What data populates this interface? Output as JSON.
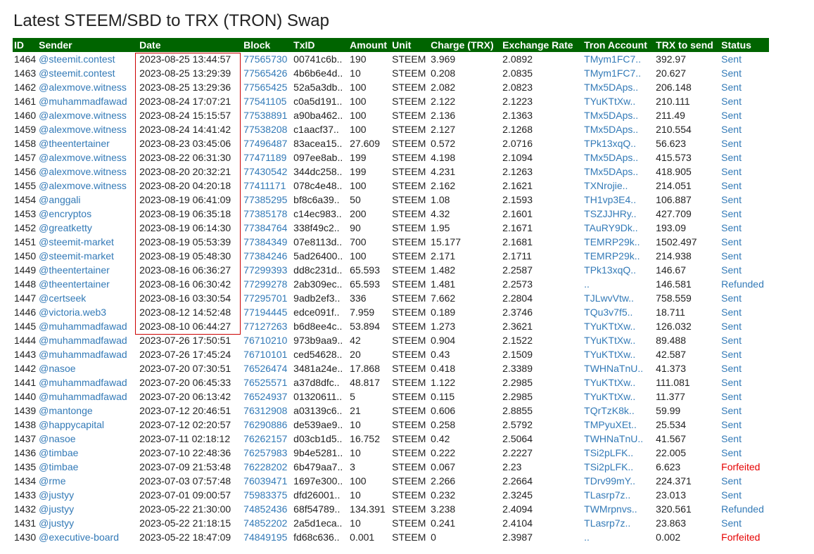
{
  "page": {
    "title": "Latest STEEM/SBD to TRX (TRON) Swap"
  },
  "colors": {
    "header_bg": "#006400",
    "link": "#337ab7",
    "forfeited": "#e60000",
    "highlight_border": "#cc0000"
  },
  "table": {
    "headers": [
      "ID",
      "Sender",
      "Date",
      "Block",
      "TxID",
      "Amount",
      "Unit",
      "Charge (TRX)",
      "Exchange Rate",
      "Tron Account",
      "TRX to send",
      "Status"
    ],
    "rows": [
      {
        "id": "1464",
        "sender": "@steemit.contest",
        "date": "2023-08-25 13:44:57",
        "block": "77565730",
        "txid": "00741c6b..",
        "amount": "190",
        "unit": "STEEM",
        "charge": "3.969",
        "rate": "2.0892",
        "tron": "TMym1FC7..",
        "trx": "392.97",
        "status": "Sent"
      },
      {
        "id": "1463",
        "sender": "@steemit.contest",
        "date": "2023-08-25 13:29:39",
        "block": "77565426",
        "txid": "4b6b6e4d..",
        "amount": "10",
        "unit": "STEEM",
        "charge": "0.208",
        "rate": "2.0835",
        "tron": "TMym1FC7..",
        "trx": "20.627",
        "status": "Sent"
      },
      {
        "id": "1462",
        "sender": "@alexmove.witness",
        "date": "2023-08-25 13:29:36",
        "block": "77565425",
        "txid": "52a5a3db..",
        "amount": "100",
        "unit": "STEEM",
        "charge": "2.082",
        "rate": "2.0823",
        "tron": "TMx5DAps..",
        "trx": "206.148",
        "status": "Sent"
      },
      {
        "id": "1461",
        "sender": "@muhammadfawad",
        "date": "2023-08-24 17:07:21",
        "block": "77541105",
        "txid": "c0a5d191..",
        "amount": "100",
        "unit": "STEEM",
        "charge": "2.122",
        "rate": "2.1223",
        "tron": "TYuKTtXw..",
        "trx": "210.111",
        "status": "Sent"
      },
      {
        "id": "1460",
        "sender": "@alexmove.witness",
        "date": "2023-08-24 15:15:57",
        "block": "77538891",
        "txid": "a90ba462..",
        "amount": "100",
        "unit": "STEEM",
        "charge": "2.136",
        "rate": "2.1363",
        "tron": "TMx5DAps..",
        "trx": "211.49",
        "status": "Sent"
      },
      {
        "id": "1459",
        "sender": "@alexmove.witness",
        "date": "2023-08-24 14:41:42",
        "block": "77538208",
        "txid": "c1aacf37..",
        "amount": "100",
        "unit": "STEEM",
        "charge": "2.127",
        "rate": "2.1268",
        "tron": "TMx5DAps..",
        "trx": "210.554",
        "status": "Sent"
      },
      {
        "id": "1458",
        "sender": "@theentertainer",
        "date": "2023-08-23 03:45:06",
        "block": "77496487",
        "txid": "83acea15..",
        "amount": "27.609",
        "unit": "STEEM",
        "charge": "0.572",
        "rate": "2.0716",
        "tron": "TPk13xqQ..",
        "trx": "56.623",
        "status": "Sent"
      },
      {
        "id": "1457",
        "sender": "@alexmove.witness",
        "date": "2023-08-22 06:31:30",
        "block": "77471189",
        "txid": "097ee8ab..",
        "amount": "199",
        "unit": "STEEM",
        "charge": "4.198",
        "rate": "2.1094",
        "tron": "TMx5DAps..",
        "trx": "415.573",
        "status": "Sent"
      },
      {
        "id": "1456",
        "sender": "@alexmove.witness",
        "date": "2023-08-20 20:32:21",
        "block": "77430542",
        "txid": "344dc258..",
        "amount": "199",
        "unit": "STEEM",
        "charge": "4.231",
        "rate": "2.1263",
        "tron": "TMx5DAps..",
        "trx": "418.905",
        "status": "Sent"
      },
      {
        "id": "1455",
        "sender": "@alexmove.witness",
        "date": "2023-08-20 04:20:18",
        "block": "77411171",
        "txid": "078c4e48..",
        "amount": "100",
        "unit": "STEEM",
        "charge": "2.162",
        "rate": "2.1621",
        "tron": "TXNrojie..",
        "trx": "214.051",
        "status": "Sent"
      },
      {
        "id": "1454",
        "sender": "@anggali",
        "date": "2023-08-19 06:41:09",
        "block": "77385295",
        "txid": "bf8c6a39..",
        "amount": "50",
        "unit": "STEEM",
        "charge": "1.08",
        "rate": "2.1593",
        "tron": "TH1vp3E4..",
        "trx": "106.887",
        "status": "Sent"
      },
      {
        "id": "1453",
        "sender": "@encryptos",
        "date": "2023-08-19 06:35:18",
        "block": "77385178",
        "txid": "c14ec983..",
        "amount": "200",
        "unit": "STEEM",
        "charge": "4.32",
        "rate": "2.1601",
        "tron": "TSZJJHRy..",
        "trx": "427.709",
        "status": "Sent"
      },
      {
        "id": "1452",
        "sender": "@greatketty",
        "date": "2023-08-19 06:14:30",
        "block": "77384764",
        "txid": "338f49c2..",
        "amount": "90",
        "unit": "STEEM",
        "charge": "1.95",
        "rate": "2.1671",
        "tron": "TAuRY9Dk..",
        "trx": "193.09",
        "status": "Sent"
      },
      {
        "id": "1451",
        "sender": "@steemit-market",
        "date": "2023-08-19 05:53:39",
        "block": "77384349",
        "txid": "07e8113d..",
        "amount": "700",
        "unit": "STEEM",
        "charge": "15.177",
        "rate": "2.1681",
        "tron": "TEMRP29k..",
        "trx": "1502.497",
        "status": "Sent"
      },
      {
        "id": "1450",
        "sender": "@steemit-market",
        "date": "2023-08-19 05:48:30",
        "block": "77384246",
        "txid": "5ad26400..",
        "amount": "100",
        "unit": "STEEM",
        "charge": "2.171",
        "rate": "2.1711",
        "tron": "TEMRP29k..",
        "trx": "214.938",
        "status": "Sent"
      },
      {
        "id": "1449",
        "sender": "@theentertainer",
        "date": "2023-08-16 06:36:27",
        "block": "77299393",
        "txid": "dd8c231d..",
        "amount": "65.593",
        "unit": "STEEM",
        "charge": "1.482",
        "rate": "2.2587",
        "tron": "TPk13xqQ..",
        "trx": "146.67",
        "status": "Sent"
      },
      {
        "id": "1448",
        "sender": "@theentertainer",
        "date": "2023-08-16 06:30:42",
        "block": "77299278",
        "txid": "2ab309ec..",
        "amount": "65.593",
        "unit": "STEEM",
        "charge": "1.481",
        "rate": "2.2573",
        "tron": "..",
        "trx": "146.581",
        "status": "Refunded"
      },
      {
        "id": "1447",
        "sender": "@certseek",
        "date": "2023-08-16 03:30:54",
        "block": "77295701",
        "txid": "9adb2ef3..",
        "amount": "336",
        "unit": "STEEM",
        "charge": "7.662",
        "rate": "2.2804",
        "tron": "TJLwvVtw..",
        "trx": "758.559",
        "status": "Sent"
      },
      {
        "id": "1446",
        "sender": "@victoria.web3",
        "date": "2023-08-12 14:52:48",
        "block": "77194445",
        "txid": "edce091f..",
        "amount": "7.959",
        "unit": "STEEM",
        "charge": "0.189",
        "rate": "2.3746",
        "tron": "TQu3v7f5..",
        "trx": "18.711",
        "status": "Sent"
      },
      {
        "id": "1445",
        "sender": "@muhammadfawad",
        "date": "2023-08-10 06:44:27",
        "block": "77127263",
        "txid": "b6d8ee4c..",
        "amount": "53.894",
        "unit": "STEEM",
        "charge": "1.273",
        "rate": "2.3621",
        "tron": "TYuKTtXw..",
        "trx": "126.032",
        "status": "Sent"
      },
      {
        "id": "1444",
        "sender": "@muhammadfawad",
        "date": "2023-07-26 17:50:51",
        "block": "76710210",
        "txid": "973b9aa9..",
        "amount": "42",
        "unit": "STEEM",
        "charge": "0.904",
        "rate": "2.1522",
        "tron": "TYuKTtXw..",
        "trx": "89.488",
        "status": "Sent"
      },
      {
        "id": "1443",
        "sender": "@muhammadfawad",
        "date": "2023-07-26 17:45:24",
        "block": "76710101",
        "txid": "ced54628..",
        "amount": "20",
        "unit": "STEEM",
        "charge": "0.43",
        "rate": "2.1509",
        "tron": "TYuKTtXw..",
        "trx": "42.587",
        "status": "Sent"
      },
      {
        "id": "1442",
        "sender": "@nasoe",
        "date": "2023-07-20 07:30:51",
        "block": "76526474",
        "txid": "3481a24e..",
        "amount": "17.868",
        "unit": "STEEM",
        "charge": "0.418",
        "rate": "2.3389",
        "tron": "TWHNaTnU..",
        "trx": "41.373",
        "status": "Sent"
      },
      {
        "id": "1441",
        "sender": "@muhammadfawad",
        "date": "2023-07-20 06:45:33",
        "block": "76525571",
        "txid": "a37d8dfc..",
        "amount": "48.817",
        "unit": "STEEM",
        "charge": "1.122",
        "rate": "2.2985",
        "tron": "TYuKTtXw..",
        "trx": "111.081",
        "status": "Sent"
      },
      {
        "id": "1440",
        "sender": "@muhammadfawad",
        "date": "2023-07-20 06:13:42",
        "block": "76524937",
        "txid": "01320611..",
        "amount": "5",
        "unit": "STEEM",
        "charge": "0.115",
        "rate": "2.2985",
        "tron": "TYuKTtXw..",
        "trx": "11.377",
        "status": "Sent"
      },
      {
        "id": "1439",
        "sender": "@mantonge",
        "date": "2023-07-12 20:46:51",
        "block": "76312908",
        "txid": "a03139c6..",
        "amount": "21",
        "unit": "STEEM",
        "charge": "0.606",
        "rate": "2.8855",
        "tron": "TQrTzK8k..",
        "trx": "59.99",
        "status": "Sent"
      },
      {
        "id": "1438",
        "sender": "@happycapital",
        "date": "2023-07-12 02:20:57",
        "block": "76290886",
        "txid": "de539ae9..",
        "amount": "10",
        "unit": "STEEM",
        "charge": "0.258",
        "rate": "2.5792",
        "tron": "TMPyuXEt..",
        "trx": "25.534",
        "status": "Sent"
      },
      {
        "id": "1437",
        "sender": "@nasoe",
        "date": "2023-07-11 02:18:12",
        "block": "76262157",
        "txid": "d03cb1d5..",
        "amount": "16.752",
        "unit": "STEEM",
        "charge": "0.42",
        "rate": "2.5064",
        "tron": "TWHNaTnU..",
        "trx": "41.567",
        "status": "Sent"
      },
      {
        "id": "1436",
        "sender": "@timbae",
        "date": "2023-07-10 22:48:36",
        "block": "76257983",
        "txid": "9b4e5281..",
        "amount": "10",
        "unit": "STEEM",
        "charge": "0.222",
        "rate": "2.2227",
        "tron": "TSi2pLFK..",
        "trx": "22.005",
        "status": "Sent"
      },
      {
        "id": "1435",
        "sender": "@timbae",
        "date": "2023-07-09 21:53:48",
        "block": "76228202",
        "txid": "6b479aa7..",
        "amount": "3",
        "unit": "STEEM",
        "charge": "0.067",
        "rate": "2.23",
        "tron": "TSi2pLFK..",
        "trx": "6.623",
        "status": "Forfeited"
      },
      {
        "id": "1434",
        "sender": "@rme",
        "date": "2023-07-03 07:57:48",
        "block": "76039471",
        "txid": "1697e300..",
        "amount": "100",
        "unit": "STEEM",
        "charge": "2.266",
        "rate": "2.2664",
        "tron": "TDrv99mY..",
        "trx": "224.371",
        "status": "Sent"
      },
      {
        "id": "1433",
        "sender": "@justyy",
        "date": "2023-07-01 09:00:57",
        "block": "75983375",
        "txid": "dfd26001..",
        "amount": "10",
        "unit": "STEEM",
        "charge": "0.232",
        "rate": "2.3245",
        "tron": "TLasrp7z..",
        "trx": "23.013",
        "status": "Sent"
      },
      {
        "id": "1432",
        "sender": "@justyy",
        "date": "2023-05-22 21:30:00",
        "block": "74852436",
        "txid": "68f54789..",
        "amount": "134.391",
        "unit": "STEEM",
        "charge": "3.238",
        "rate": "2.4094",
        "tron": "TWMrpnvs..",
        "trx": "320.561",
        "status": "Refunded"
      },
      {
        "id": "1431",
        "sender": "@justyy",
        "date": "2023-05-22 21:18:15",
        "block": "74852202",
        "txid": "2a5d1eca..",
        "amount": "10",
        "unit": "STEEM",
        "charge": "0.241",
        "rate": "2.4104",
        "tron": "TLasrp7z..",
        "trx": "23.863",
        "status": "Sent"
      },
      {
        "id": "1430",
        "sender": "@executive-board",
        "date": "2023-05-22 18:47:09",
        "block": "74849195",
        "txid": "fd68c636..",
        "amount": "0.001",
        "unit": "STEEM",
        "charge": "0",
        "rate": "2.3987",
        "tron": "..",
        "trx": "0.002",
        "status": "Forfeited"
      }
    ]
  }
}
